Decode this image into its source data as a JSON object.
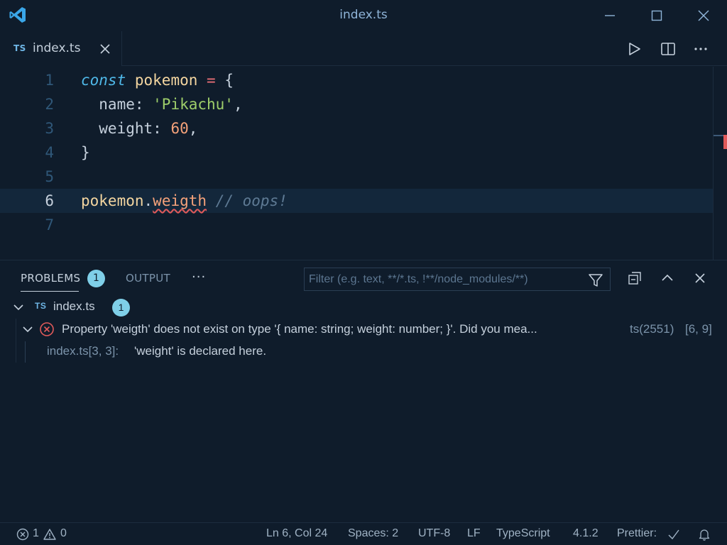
{
  "window": {
    "title": "index.ts"
  },
  "tab": {
    "icon_text": "TS",
    "label": "index.ts"
  },
  "editor": {
    "line_numbers": [
      "1",
      "2",
      "3",
      "4",
      "5",
      "6",
      "7"
    ],
    "active_line": 6,
    "lines": [
      {
        "t1": "const",
        "t2": " ",
        "t3": "pokemon",
        "t4": " ",
        "t5": "=",
        "t6": " {"
      },
      {
        "t1": "  name: ",
        "t2": "'Pikachu'",
        "t3": ","
      },
      {
        "t1": "  weight: ",
        "t2": "60",
        "t3": ","
      },
      {
        "t1": "}"
      },
      {
        "t1": ""
      },
      {
        "t1": "pokemon",
        "t2": ".",
        "t3": "weigth",
        "t4": " ",
        "t5": "// oops!"
      },
      {
        "t1": ""
      }
    ]
  },
  "panel": {
    "tabs": {
      "problems": "PROBLEMS",
      "output": "OUTPUT"
    },
    "problems_count": "1",
    "more": "···",
    "filter_placeholder": "Filter (e.g. text, **/*.ts, !**/node_modules/**)",
    "file": {
      "icon_text": "TS",
      "name": "index.ts",
      "count": "1"
    },
    "problem": {
      "message": "Property 'weigth' does not exist on type '{ name: string; weight: number; }'. Did you mea...",
      "code": "ts(2551)",
      "position": "[6, 9]"
    },
    "related": {
      "location": "index.ts[3, 3]:",
      "message": "'weight' is declared here."
    }
  },
  "statusbar": {
    "errors": "1",
    "warnings": "0",
    "cursor": "Ln 6, Col 24",
    "spaces": "Spaces: 2",
    "encoding": "UTF-8",
    "eol": "LF",
    "language": "TypeScript",
    "ts_version": "4.1.2",
    "prettier": "Prettier:"
  },
  "colors": {
    "background": "#0f1c2b",
    "keyword": "#4fb8e8",
    "string": "#9ece6a",
    "number": "#f5a27a",
    "error": "#e05a5a",
    "badge": "#7fcfe8"
  }
}
